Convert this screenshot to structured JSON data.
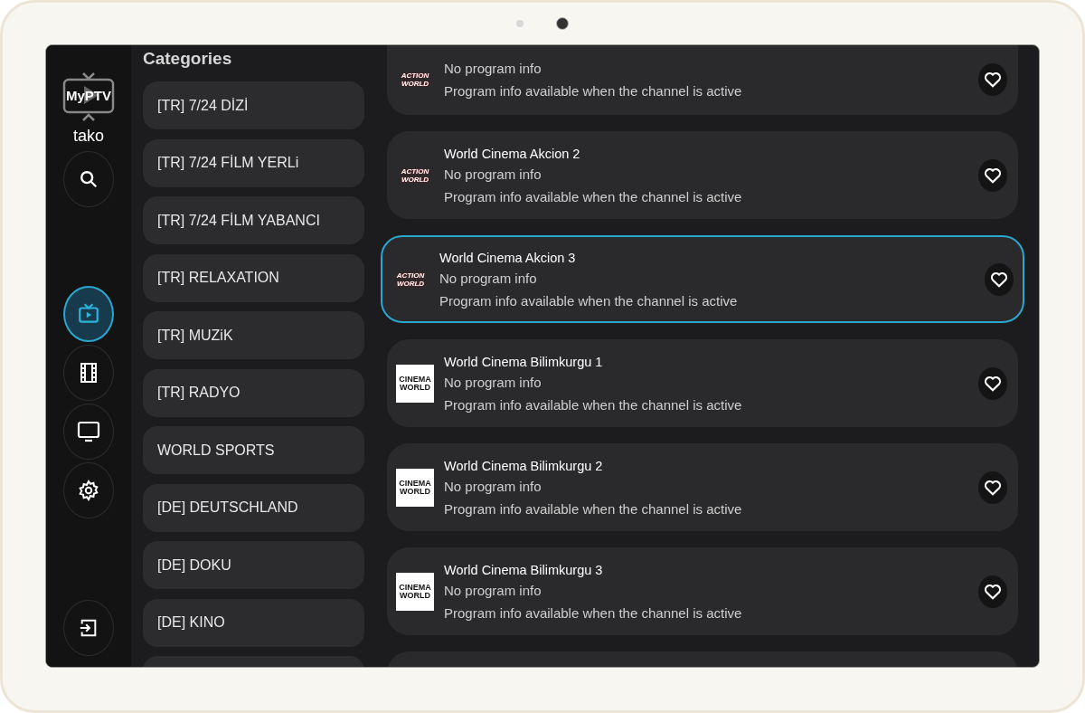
{
  "sidebar": {
    "logo_text": "MyPTV",
    "username": "tako",
    "nav": [
      {
        "kind": "live",
        "selected": true
      },
      {
        "kind": "movies",
        "selected": false
      },
      {
        "kind": "series",
        "selected": false
      },
      {
        "kind": "settings",
        "selected": false
      }
    ]
  },
  "categories": {
    "title": "Categories",
    "items": [
      {
        "label": "[TR] 7/24 DİZİ",
        "selected": false
      },
      {
        "label": "[TR] 7/24 FİLM YERLi",
        "selected": false
      },
      {
        "label": "[TR] 7/24 FİLM YABANCI",
        "selected": false
      },
      {
        "label": "[TR] RELAXATION",
        "selected": false
      },
      {
        "label": "[TR] MUZiK",
        "selected": false
      },
      {
        "label": "[TR] RADYO",
        "selected": false
      },
      {
        "label": "WORLD SPORTS",
        "selected": false
      },
      {
        "label": "[DE] DEUTSCHLAND",
        "selected": false
      },
      {
        "label": "[DE] DOKU",
        "selected": false
      },
      {
        "label": "[DE] KINO",
        "selected": false
      }
    ]
  },
  "channels": [
    {
      "logo": {
        "kind": "action",
        "lines": [
          "ACTION",
          "WORLD"
        ]
      },
      "program": "No program info",
      "note": "Program info available when the channel is active",
      "favorite": false,
      "selected": false
    },
    {
      "name": "World Cinema Akcion 2",
      "logo": {
        "kind": "action",
        "lines": [
          "ACTION",
          "WORLD"
        ]
      },
      "program": "No program info",
      "note": "Program info available when the channel is active",
      "favorite": false,
      "selected": false
    },
    {
      "name": "World Cinema Akcion 3",
      "logo": {
        "kind": "action",
        "lines": [
          "ACTION",
          "WORLD"
        ]
      },
      "program": "No program info",
      "note": "Program info available when the channel is active",
      "favorite": false,
      "selected": true
    },
    {
      "name": "World Cinema Bilimkurgu 1",
      "logo": {
        "kind": "cinema",
        "lines": [
          "CINEMA",
          "WORLD"
        ]
      },
      "program": "No program info",
      "note": "Program info available when the channel is active",
      "favorite": false,
      "selected": false
    },
    {
      "name": "World Cinema Bilimkurgu 2",
      "logo": {
        "kind": "cinema",
        "lines": [
          "CINEMA",
          "WORLD"
        ]
      },
      "program": "No program info",
      "note": "Program info available when the channel is active",
      "favorite": false,
      "selected": false
    },
    {
      "name": "World Cinema Bilimkurgu 3",
      "logo": {
        "kind": "cinema",
        "lines": [
          "CINEMA",
          "WORLD"
        ]
      },
      "program": "No program info",
      "note": "Program info available when the channel is active",
      "favorite": false,
      "selected": false
    }
  ]
}
